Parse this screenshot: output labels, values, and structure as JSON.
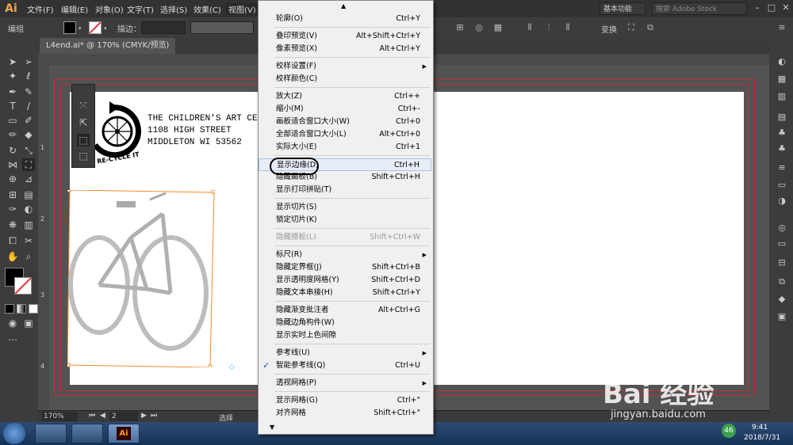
{
  "app": {
    "logo": "Ai"
  },
  "menubar": {
    "items": [
      "文件(F)",
      "编辑(E)",
      "对象(O)",
      "文字(T)",
      "选择(S)",
      "效果(C)",
      "视图(V)"
    ],
    "workspace": "基本功能",
    "search_placeholder": "搜索 Adobe Stock"
  },
  "control": {
    "label": "编组",
    "stroke_label": "描边：",
    "transform_label": "变换"
  },
  "document": {
    "tab": "L4end.ai* @ 170% (CMYK/预览)"
  },
  "ruler": {
    "marks": [
      "1",
      "2",
      "3",
      "4"
    ]
  },
  "artwork": {
    "address": [
      "THE CHILDREN'S ART CE",
      "1108 HIGH STREET",
      "MIDDLETON WI 53562"
    ],
    "logo_text": "RE-CYCLE IT"
  },
  "status": {
    "zoom": "170%",
    "page": "2",
    "mode": "选择"
  },
  "menu": {
    "items": [
      {
        "label": "轮廓(O)",
        "shortcut": "Ctrl+Y"
      },
      {
        "sep": true
      },
      {
        "label": "叠印预览(V)",
        "shortcut": "Alt+Shift+Ctrl+Y"
      },
      {
        "label": "像素预览(X)",
        "shortcut": "Alt+Ctrl+Y"
      },
      {
        "sep": true
      },
      {
        "label": "校样设置(F)",
        "shortcut": "",
        "submenu": true
      },
      {
        "label": "校样颜色(C)",
        "shortcut": ""
      },
      {
        "sep": true
      },
      {
        "label": "放大(Z)",
        "shortcut": "Ctrl++"
      },
      {
        "label": "缩小(M)",
        "shortcut": "Ctrl+-"
      },
      {
        "label": "画板适合窗口大小(W)",
        "shortcut": "Ctrl+0"
      },
      {
        "label": "全部适合窗口大小(L)",
        "shortcut": "Alt+Ctrl+0"
      },
      {
        "label": "实际大小(E)",
        "shortcut": "Ctrl+1"
      },
      {
        "sep": true
      },
      {
        "label": "显示边缘(D)",
        "shortcut": "Ctrl+H",
        "highlight": true
      },
      {
        "label": "隐藏画板(B)",
        "shortcut": "Shift+Ctrl+H"
      },
      {
        "label": "显示打印拼贴(T)",
        "shortcut": ""
      },
      {
        "sep": true
      },
      {
        "label": "显示切片(S)",
        "shortcut": ""
      },
      {
        "label": "锁定切片(K)",
        "shortcut": ""
      },
      {
        "sep": true
      },
      {
        "label": "隐藏模板(L)",
        "shortcut": "Shift+Ctrl+W",
        "disabled": true
      },
      {
        "sep": true
      },
      {
        "label": "标尺(R)",
        "shortcut": "",
        "submenu": true
      },
      {
        "label": "隐藏定界框(J)",
        "shortcut": "Shift+Ctrl+B"
      },
      {
        "label": "显示透明度网格(Y)",
        "shortcut": "Shift+Ctrl+D"
      },
      {
        "label": "隐藏文本串接(H)",
        "shortcut": "Shift+Ctrl+Y"
      },
      {
        "sep": true
      },
      {
        "label": "隐藏渐变批注者",
        "shortcut": "Alt+Ctrl+G"
      },
      {
        "label": "隐藏边角构件(W)",
        "shortcut": ""
      },
      {
        "label": "显示实时上色间隙",
        "shortcut": ""
      },
      {
        "sep": true
      },
      {
        "label": "参考线(U)",
        "shortcut": "",
        "submenu": true
      },
      {
        "label": "智能参考线(Q)",
        "shortcut": "Ctrl+U",
        "checked": true
      },
      {
        "sep": true
      },
      {
        "label": "透视网格(P)",
        "shortcut": "",
        "submenu": true
      },
      {
        "sep": true
      },
      {
        "label": "显示网格(G)",
        "shortcut": "Ctrl+\""
      },
      {
        "label": "对齐网格",
        "shortcut": "Shift+Ctrl+\""
      }
    ]
  },
  "taskbar": {
    "time": "9:41",
    "date": "2018/7/31",
    "badge": "46"
  },
  "watermark": {
    "text": "Bai 经验",
    "url": "jingyan.baidu.com"
  }
}
